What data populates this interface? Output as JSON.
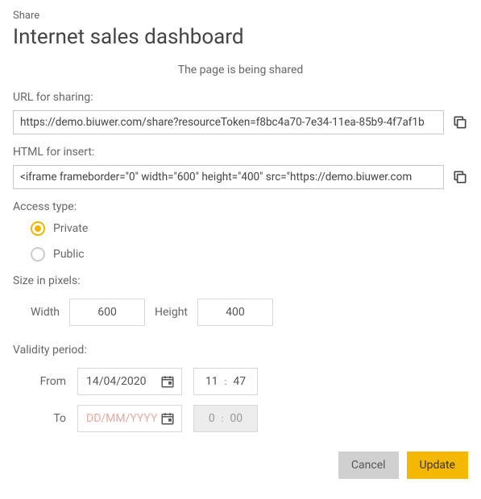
{
  "header": {
    "small_title": "Share",
    "main_title": "Internet sales dashboard"
  },
  "status_message": "The page is being shared",
  "url_section": {
    "label": "URL for sharing:",
    "value": "https://demo.biuwer.com/share?resourceToken=f8bc4a70-7e34-11ea-85b9-4f7af1b"
  },
  "html_section": {
    "label": "HTML for insert:",
    "value": "<iframe frameborder=\"0\" width=\"600\" height=\"400\" src=\"https://demo.biuwer.com"
  },
  "access": {
    "label": "Access type:",
    "options": {
      "private": "Private",
      "public": "Public"
    },
    "selected": "private"
  },
  "size": {
    "label": "Size in pixels:",
    "width_label": "Width",
    "width_value": "600",
    "height_label": "Height",
    "height_value": "400"
  },
  "validity": {
    "label": "Validity period:",
    "from_label": "From",
    "from_date": "14/04/2020",
    "from_hour": "11",
    "from_minute": "47",
    "to_label": "To",
    "to_date_placeholder": "DD/MM/YYYY",
    "to_hour": "0",
    "to_minute": "00"
  },
  "buttons": {
    "cancel": "Cancel",
    "update": "Update"
  }
}
